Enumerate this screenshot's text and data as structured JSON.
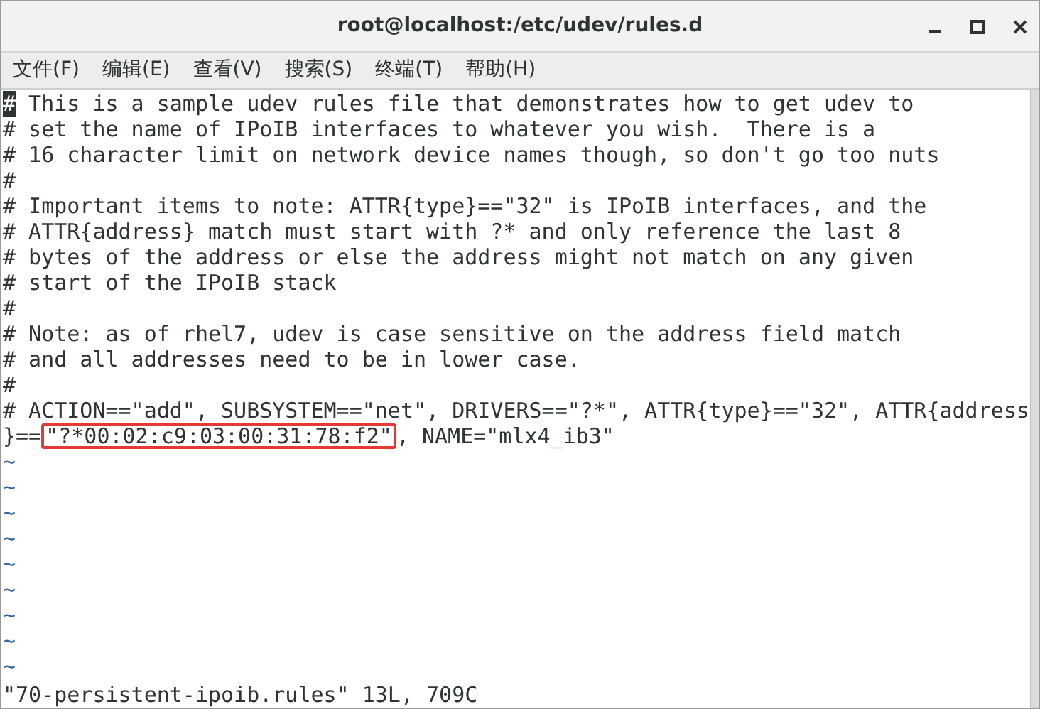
{
  "window": {
    "title": "root@localhost:/etc/udev/rules.d"
  },
  "menu": [
    "文件(F)",
    "编辑(E)",
    "查看(V)",
    "搜索(S)",
    "终端(T)",
    "帮助(H)"
  ],
  "lines": [
    [
      {
        "kind": "cursor",
        "text": "#"
      },
      {
        "kind": "plain",
        "text": " This is a sample udev rules file that demonstrates how to get udev to"
      }
    ],
    [
      {
        "kind": "plain",
        "text": "# set the name of IPoIB interfaces to whatever you wish.  There is a"
      }
    ],
    [
      {
        "kind": "plain",
        "text": "# 16 character limit on network device names though, so don't go too nuts"
      }
    ],
    [
      {
        "kind": "plain",
        "text": "#"
      }
    ],
    [
      {
        "kind": "plain",
        "text": "# Important items to note: ATTR{type}==\"32\" is IPoIB interfaces, and the"
      }
    ],
    [
      {
        "kind": "plain",
        "text": "# ATTR{address} match must start with ?* and only reference the last 8"
      }
    ],
    [
      {
        "kind": "plain",
        "text": "# bytes of the address or else the address might not match on any given"
      }
    ],
    [
      {
        "kind": "plain",
        "text": "# start of the IPoIB stack"
      }
    ],
    [
      {
        "kind": "plain",
        "text": "#"
      }
    ],
    [
      {
        "kind": "plain",
        "text": "# Note: as of rhel7, udev is case sensitive on the address field match"
      }
    ],
    [
      {
        "kind": "plain",
        "text": "# and all addresses need to be in lower case."
      }
    ],
    [
      {
        "kind": "plain",
        "text": "#"
      }
    ],
    [
      {
        "kind": "plain",
        "text": "# ACTION==\"add\", SUBSYSTEM==\"net\", DRIVERS==\"?*\", ATTR{type}==\"32\", ATTR{address"
      }
    ],
    [
      {
        "kind": "plain",
        "text": "}=="
      },
      {
        "kind": "boxed",
        "text": "\"?*00:02:c9:03:00:31:78:f2\""
      },
      {
        "kind": "plain",
        "text": ", NAME=\"mlx4_ib3\""
      }
    ]
  ],
  "tildes": [
    "~",
    "~",
    "~",
    "~",
    "~",
    "~",
    "~",
    "~",
    "~"
  ],
  "status_line": "\"70-persistent-ipoib.rules\" 13L, 709C"
}
